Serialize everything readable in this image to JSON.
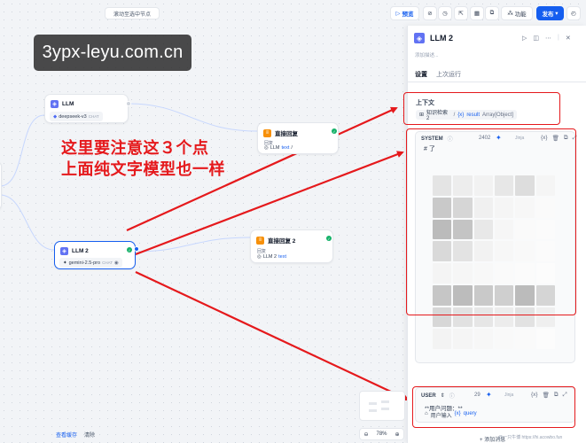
{
  "header": {
    "hint": "滚动至选中节点",
    "preview_label": "预览",
    "feature_label": "功能",
    "publish_label": "发布"
  },
  "watermark": {
    "site": "3ypx-leyu.com.cn"
  },
  "nodes": {
    "llm1": {
      "title": "LLM",
      "model": "deepseek-v3",
      "tag": "CHAT"
    },
    "answer1": {
      "title": "直接回复",
      "sub": "回复",
      "var_node": "LLM",
      "var_name": "text",
      "suffix": "/"
    },
    "llm2": {
      "title": "LLM 2",
      "model": "gemini-2.5-pro",
      "tag": "CHAT"
    },
    "answer2": {
      "title": "直接回复 2",
      "sub": "回复",
      "var_node": "LLM 2",
      "var_name": "text"
    }
  },
  "annotation": {
    "line1": "这里要注意这３个点",
    "line2": "上面纯文字模型也一样"
  },
  "panel": {
    "title": "LLM 2",
    "description_placeholder": "添加描述...",
    "tabs": [
      {
        "label": "设置"
      },
      {
        "label": "上次运行"
      }
    ],
    "context": {
      "label": "上下文",
      "var_node": "知识检索 2",
      "var_name": "result",
      "var_type": "Array[Object]"
    },
    "system": {
      "role": "SYSTEM",
      "count": "2402",
      "jinja": "Jinja",
      "first_line": "# 了"
    },
    "user": {
      "role": "USER",
      "count": "29",
      "jinja": "Jinja",
      "line1": "**用户问题：**",
      "var_node": "用户输入",
      "var_name": "query"
    },
    "add_message": "添加消息"
  },
  "canvas": {
    "zoom": "78%",
    "view_cache": "查看缓存",
    "clear": "清除",
    "credit": "@一只牛博 https://hi.acowbo.fun"
  }
}
